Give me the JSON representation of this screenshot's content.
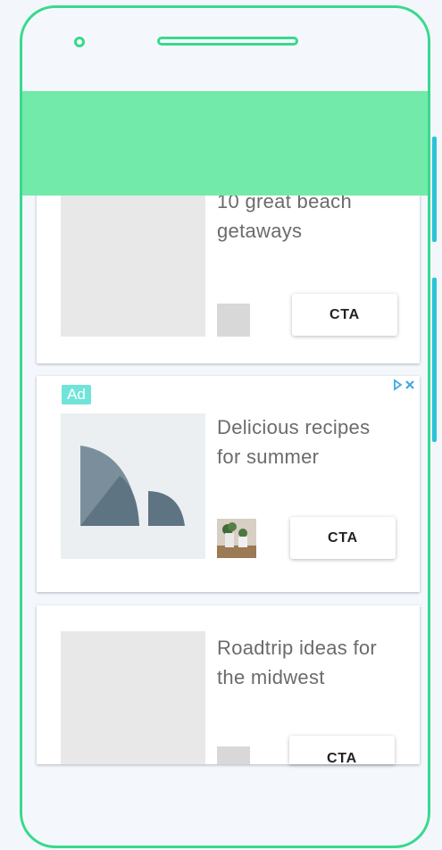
{
  "feed": {
    "cards": [
      {
        "title_line1": "10 great beach",
        "title_line2": "getaways",
        "cta": "CTA"
      },
      {
        "ad_badge": "Ad",
        "adchoices_icon": "adchoices-icon",
        "title_line1": "Delicious recipes",
        "title_line2": "for summer",
        "cta": "CTA"
      },
      {
        "title_line1": "Roadtrip ideas for",
        "title_line2": "the midwest",
        "cta": "CTA"
      }
    ]
  },
  "colors": {
    "frame": "#38d98c",
    "header": "#72eaaa",
    "side_buttons": "#2bc3d8",
    "ad_badge": "#70e4d8"
  },
  "icons": [
    "camera-icon",
    "speaker-icon",
    "adchoices-icon",
    "plant-image"
  ]
}
